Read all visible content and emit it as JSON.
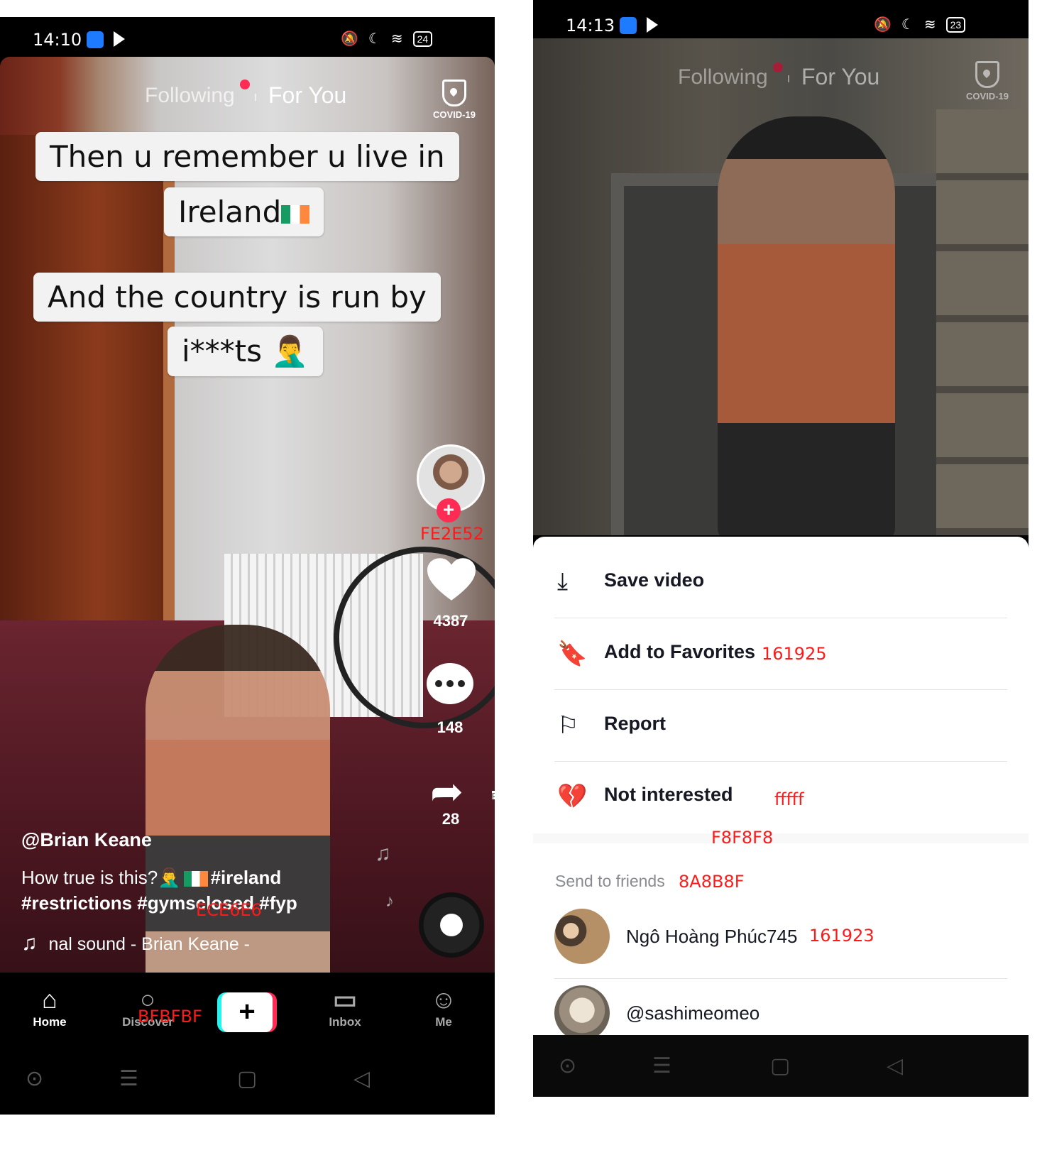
{
  "left": {
    "status": {
      "time": "14:10",
      "battery": "24"
    },
    "tabs": {
      "following": "Following",
      "for_you": "For You"
    },
    "covid_label": "COVID-19",
    "captions": {
      "c1_line1": "Then u remember u live in",
      "c1_line2": "Ireland",
      "c2_line1": "And the country is run by",
      "c2_line2": "i***ts 🤦‍♂️"
    },
    "rail": {
      "likes": "4387",
      "comments": "148",
      "shares": "28"
    },
    "username": "@Brian Keane",
    "description_line1": "How true is this?🤦‍♂️",
    "description_tag1": "#ireland",
    "description_line2": "#restrictions #gymsclosed #fyp",
    "music": "nal sound - Brian Keane -",
    "side_snippet": "psum",
    "nav": {
      "home": "Home",
      "discover": "Discover",
      "create": "+",
      "inbox": "Inbox",
      "me": "Me"
    },
    "annotations": {
      "plus_color": "FE2E52",
      "desc_color": "ECE6E6",
      "discover_color": "BFBFBF"
    }
  },
  "right": {
    "status": {
      "time": "14:13",
      "battery": "23"
    },
    "tabs": {
      "following": "Following",
      "for_you": "For You"
    },
    "covid_label": "COVID-19",
    "menu": [
      {
        "icon": "download-icon",
        "label": "Save video"
      },
      {
        "icon": "bookmark-icon",
        "label": "Add to Favorites"
      },
      {
        "icon": "flag-icon",
        "label": "Report"
      },
      {
        "icon": "broken-heart-icon",
        "label": "Not interested"
      }
    ],
    "send_to_friends": "Send to friends",
    "friends": [
      {
        "name": "Ngô Hoàng Phúc745"
      },
      {
        "name": "@sashimeomeo"
      }
    ],
    "annotations": {
      "favorites_color": "161925",
      "not_interested_color": "fffff",
      "divider_color": "F8F8F8",
      "send_color": "8A8B8F",
      "friend_color": "161923"
    }
  },
  "colors": {
    "accent": "#fe2c55",
    "cyan": "#25f4ee",
    "text_dark": "#161823",
    "muted": "#8a8b8f"
  }
}
